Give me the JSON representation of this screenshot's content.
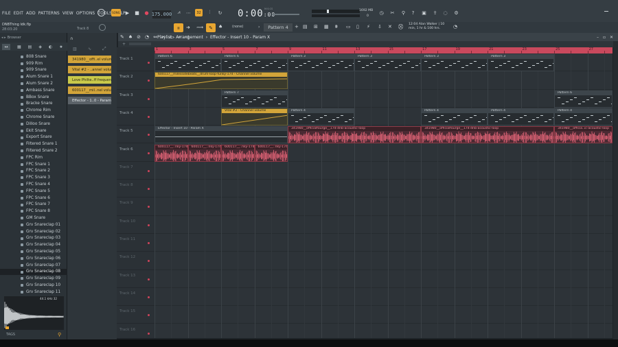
{
  "menu": [
    "FILE",
    "EDIT",
    "ADD",
    "PATTERNS",
    "VIEW",
    "OPTIONS",
    "TOOLS",
    "HELP"
  ],
  "transport": {
    "bpm": "175.000",
    "time": "0:00",
    "time_ms": "00",
    "time_unit": "M:S:CS",
    "pattern": "Pattern 4",
    "snap": "(none)",
    "cpu_mem": "1692 MB",
    "voices": "0"
  },
  "project": {
    "file": "DNBThing Idk.flp",
    "elapsed": "28:03:20",
    "channel": "Track 8"
  },
  "hint": {
    "time": "12:04",
    "text": "Alan Walker | 10",
    "text2": "min, 1 hr & 100 hrs."
  },
  "browser": {
    "title": "Browser",
    "items": [
      "808 Snare",
      "909 Rim",
      "909 Snare",
      "Alum Snare 1",
      "Alum Snare 2",
      "Ambass Snare",
      "BBox Snare",
      "Bracke Snare",
      "Chrome Rim",
      "Chrome Snare",
      "Dilloo Snare",
      "Ekit Snare",
      "Export Snare",
      "Filtered Snare 1",
      "Filtered Snare 2",
      "FPC Rim",
      "FPC Snare 1",
      "FPC Snare 2",
      "FPC Snare 3",
      "FPC Snare 4",
      "FPC Snare 5",
      "FPC Snare 6",
      "FPC Snare 7",
      "FPC Snare 8",
      "GM Snare",
      "Grv Snareclap 01",
      "Grv Snareclap 02",
      "Grv Snareclap 03",
      "Grv Snareclap 04",
      "Grv Snareclap 05",
      "Grv Snareclap 06",
      "Grv Snareclap 07",
      "Grv Snareclap 08",
      "Grv Snareclap 09",
      "Grv Snareclap 10",
      "Grv Snareclap 11"
    ],
    "selected_index": 32,
    "sample_rate": "44.1",
    "bits": "32",
    "tags": "TAGS"
  },
  "clip_sources": [
    {
      "label": "341980__offi..el volume",
      "color": "#d3a53a"
    },
    {
      "label": "Vital #2 - ..annel volume",
      "color": "#d3a53a"
    },
    {
      "label": "Love Philte..ff frequency",
      "color": "#c9c94a"
    },
    {
      "label": "600117__mil..nel volume",
      "color": "#d3a53a"
    },
    {
      "label": "Effector - 1..0 - Param X",
      "color": "#5b6268"
    }
  ],
  "playlist": {
    "breadcrumb": "Playlist - Arrangement",
    "breadcrumb2": "Effector - Insert 10 - Param X",
    "ruler": [
      "1",
      "3",
      "5",
      "7",
      "9",
      "11",
      "13",
      "15",
      "17",
      "19",
      "21",
      "23",
      "25",
      "27"
    ],
    "tracks": [
      "Track 1",
      "Track 2",
      "Track 3",
      "Track 4",
      "Track 5",
      "Track 6",
      "Track 7",
      "Track 8",
      "Track 9",
      "Track 10",
      "Track 11",
      "Track 12",
      "Track 13",
      "Track 14",
      "Track 15",
      "Track 16"
    ],
    "clips": {
      "t1": [
        "Pattern 6",
        "Pattern 6",
        "Pattern 3",
        "Pattern 3",
        "Pattern 3",
        "Pattern 3"
      ],
      "t2": "600117__milessidebeats__drum-loop-funky-174 - Channel volume",
      "t3": [
        "Pattern 7",
        "Pattern 6"
      ],
      "t4": [
        "Vital #2 - Channel volume",
        "Pattern 4",
        "Pattern 4",
        "Pattern 4",
        "Pattern 4"
      ],
      "t5": [
        "Effector - Insert 10 - Param X",
        "341980__officialfourge__174-dnb-acoustic-loop",
        "341980__officialfourge__174-dnb-acoustic-loop",
        "341980__officia..ic-acoustic-loop"
      ],
      "t6": [
        "600117__..nky-174",
        "600117__..nky-174",
        "600117__..nky-174",
        "600117__..nky-174"
      ]
    }
  },
  "colors": {
    "accent": "#d0445b",
    "pattern": "#3d454b",
    "automation": "#d3a53a",
    "audio": "#c84a5d"
  }
}
